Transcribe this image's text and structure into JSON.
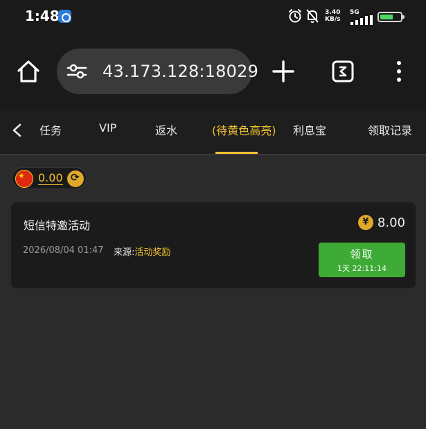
{
  "status_bar": {
    "time": "1:48",
    "speed_value": "3.40",
    "speed_unit": "KB/s",
    "network": "5G"
  },
  "browser": {
    "url": "43.173.128:18029"
  },
  "nav": {
    "tabs": [
      {
        "label": "任务"
      },
      {
        "label": "VIP"
      },
      {
        "label": "返水"
      },
      {
        "label": "(待黄色高亮)"
      },
      {
        "label": "利息宝"
      },
      {
        "label": "领取记录"
      }
    ],
    "active_index": 3
  },
  "balance": {
    "value": "0.00"
  },
  "reward_card": {
    "title": "短信特邀活动",
    "amount": "8.00",
    "date": "2026/08/04 01:47",
    "source_label": "来源:",
    "source_value": "活动奖励",
    "claim_label": "领取",
    "claim_timer": "1天 22:11:14"
  },
  "colors": {
    "accent_gold": "#f2c230",
    "claim_green": "#3dab35",
    "card_bg": "#1b1b1b",
    "page_bg": "#2b2b2b"
  }
}
